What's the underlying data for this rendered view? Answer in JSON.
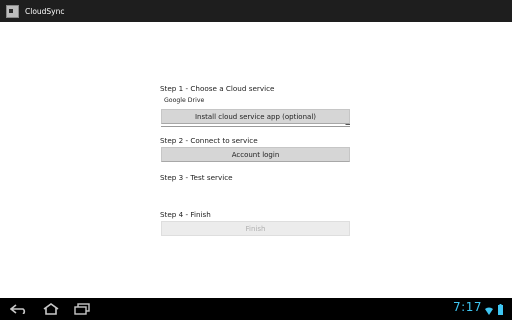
{
  "app": {
    "title": "CloudSync"
  },
  "steps": {
    "step1": {
      "label": "Step 1 - Choose a Cloud service",
      "selected_service": "Google Drive",
      "install_button": "Install cloud service app (optional)"
    },
    "step2": {
      "label": "Step 2 - Connect to service",
      "login_button": "Account login"
    },
    "step3": {
      "label": "Step 3 - Test service"
    },
    "step4": {
      "label": "Step 4 - Finish",
      "finish_button": "Finish"
    }
  },
  "system": {
    "clock": "7:17",
    "icons": [
      "back-icon",
      "home-icon",
      "recent-apps-icon",
      "wifi-icon",
      "battery-icon"
    ]
  },
  "colors": {
    "actionbar": "#1e1e1e",
    "clock": "#3fc6f2",
    "button": "#d6d6d6"
  }
}
